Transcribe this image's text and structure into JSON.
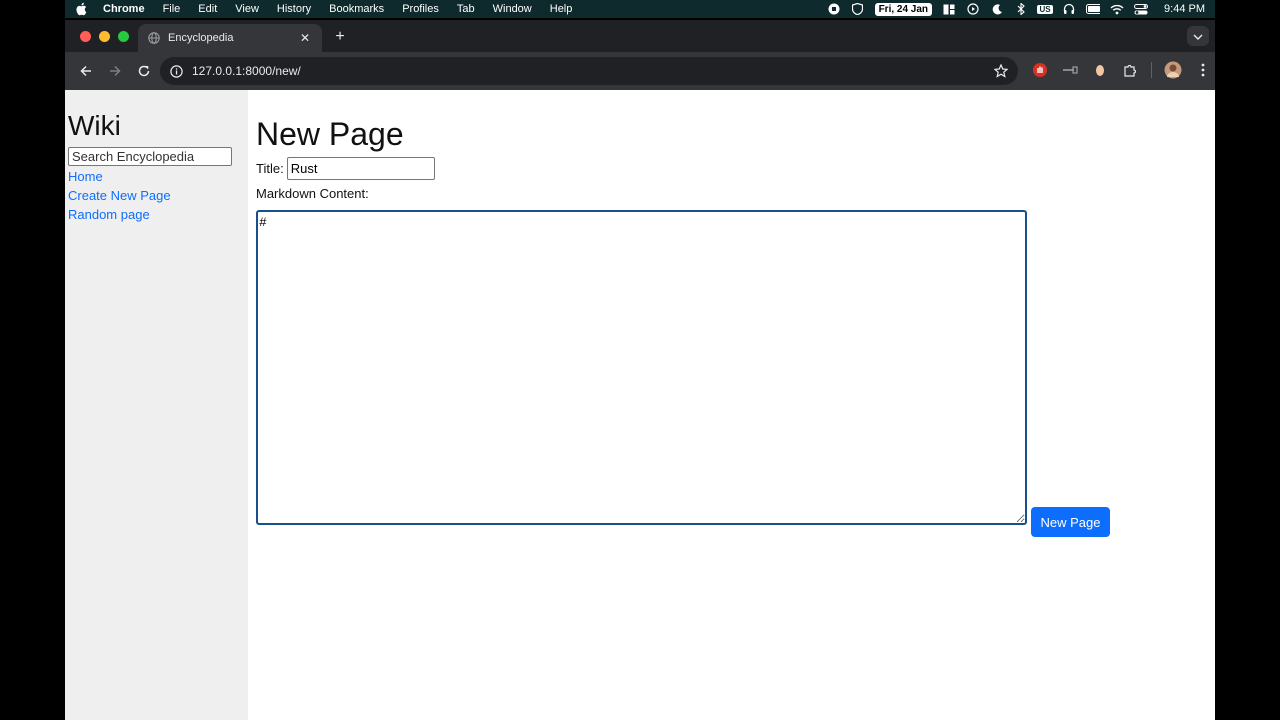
{
  "menubar": {
    "app_name": "Chrome",
    "items": [
      "File",
      "Edit",
      "View",
      "History",
      "Bookmarks",
      "Profiles",
      "Tab",
      "Window",
      "Help"
    ],
    "date": "Fri, 24 Jan",
    "input_source": "US",
    "time": "9:44 PM"
  },
  "browser": {
    "tab_title": "Encyclopedia",
    "url": "127.0.0.1:8000/new/"
  },
  "sidebar": {
    "heading": "Wiki",
    "search_placeholder": "Search Encyclopedia",
    "links": [
      "Home",
      "Create New Page",
      "Random page"
    ]
  },
  "main": {
    "heading": "New Page",
    "title_label": "Title:",
    "title_value": "Rust",
    "content_label": "Markdown Content:",
    "content_value": "#",
    "submit_label": "New Page"
  },
  "colors": {
    "link": "#0d6efd",
    "button": "#0d6efd",
    "sidebar_bg": "#efefef"
  }
}
